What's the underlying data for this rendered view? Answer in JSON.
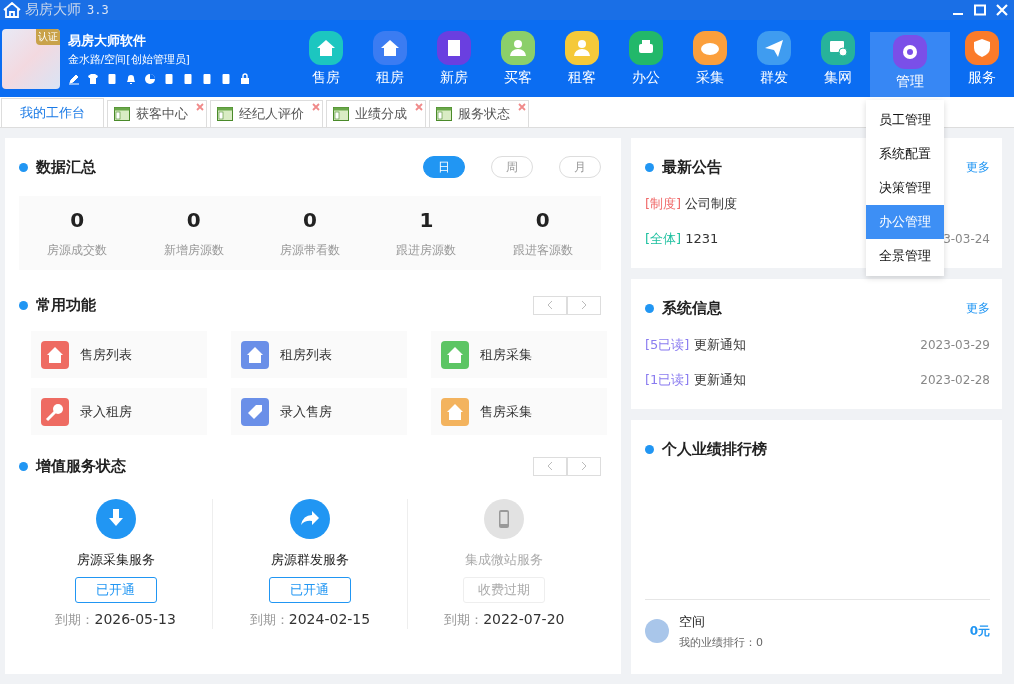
{
  "window": {
    "title": "易房大师",
    "version": "3.3"
  },
  "profile": {
    "badge": "认证",
    "company": "易房大师软件",
    "branch": "金水路/空间[创始管理员]"
  },
  "nav": [
    {
      "label": "售房",
      "selected": false
    },
    {
      "label": "租房",
      "selected": false
    },
    {
      "label": "新房",
      "selected": false
    },
    {
      "label": "买客",
      "selected": false
    },
    {
      "label": "租客",
      "selected": false
    },
    {
      "label": "办公",
      "selected": false
    },
    {
      "label": "采集",
      "selected": false
    },
    {
      "label": "群发",
      "selected": false
    },
    {
      "label": "集网",
      "selected": false
    },
    {
      "label": "管理",
      "selected": true
    },
    {
      "label": "服务",
      "selected": false
    }
  ],
  "menu": [
    {
      "label": "员工管理",
      "selected": false
    },
    {
      "label": "系统配置",
      "selected": false
    },
    {
      "label": "决策管理",
      "selected": false
    },
    {
      "label": "办公管理",
      "selected": true
    },
    {
      "label": "全景管理",
      "selected": false
    }
  ],
  "tabs": [
    {
      "label": "我的工作台",
      "selected": true,
      "closable": false
    },
    {
      "label": "获客中心",
      "selected": false,
      "closable": true
    },
    {
      "label": "经纪人评价",
      "selected": false,
      "closable": true
    },
    {
      "label": "业绩分成",
      "selected": false,
      "closable": true
    },
    {
      "label": "服务状态",
      "selected": false,
      "closable": true
    }
  ],
  "data_summary": {
    "title": "数据汇总",
    "periods": [
      {
        "label": "日",
        "selected": true
      },
      {
        "label": "周",
        "selected": false
      },
      {
        "label": "月",
        "selected": false
      }
    ],
    "stats": [
      {
        "value": "0",
        "label": "房源成交数"
      },
      {
        "value": "0",
        "label": "新增房源数"
      },
      {
        "value": "0",
        "label": "房源带看数"
      },
      {
        "value": "1",
        "label": "跟进房源数"
      },
      {
        "value": "0",
        "label": "跟进客源数"
      }
    ]
  },
  "functions": {
    "title": "常用功能",
    "items": [
      {
        "label": "售房列表"
      },
      {
        "label": "租房列表"
      },
      {
        "label": "租房采集"
      },
      {
        "label": "录入租房"
      },
      {
        "label": "录入售房"
      },
      {
        "label": "售房采集"
      }
    ]
  },
  "services": {
    "title": "增值服务状态",
    "items": [
      {
        "name": "房源采集服务",
        "status": "已开通",
        "active": true,
        "expiry_label": "到期：",
        "expiry": "2026-05-13"
      },
      {
        "name": "房源群发服务",
        "status": "已开通",
        "active": true,
        "expiry_label": "到期：",
        "expiry": "2024-02-15"
      },
      {
        "name": "集成微站服务",
        "status": "收费过期",
        "active": false,
        "expiry_label": "到期：",
        "expiry": "2022-07-20"
      }
    ]
  },
  "announcements": {
    "title": "最新公告",
    "more": "更多",
    "items": [
      {
        "tag": "[制度]",
        "color": "#f06a6a",
        "text": "公司制度"
      },
      {
        "tag": "[全体]",
        "color": "#1fc0a0",
        "text": "1231",
        "date": "3-03-24"
      }
    ]
  },
  "system_info": {
    "title": "系统信息",
    "more": "更多",
    "items": [
      {
        "tag": "[5已读]",
        "color": "#8a7cf0",
        "text": "更新通知",
        "date": "2023-03-29"
      },
      {
        "tag": "[1已读]",
        "color": "#8a7cf0",
        "text": "更新通知",
        "date": "2023-02-28"
      }
    ]
  },
  "ranking": {
    "title": "个人业绩排行榜",
    "name": "空间",
    "rank_text": "我的业绩排行：0",
    "amount": "0元"
  }
}
